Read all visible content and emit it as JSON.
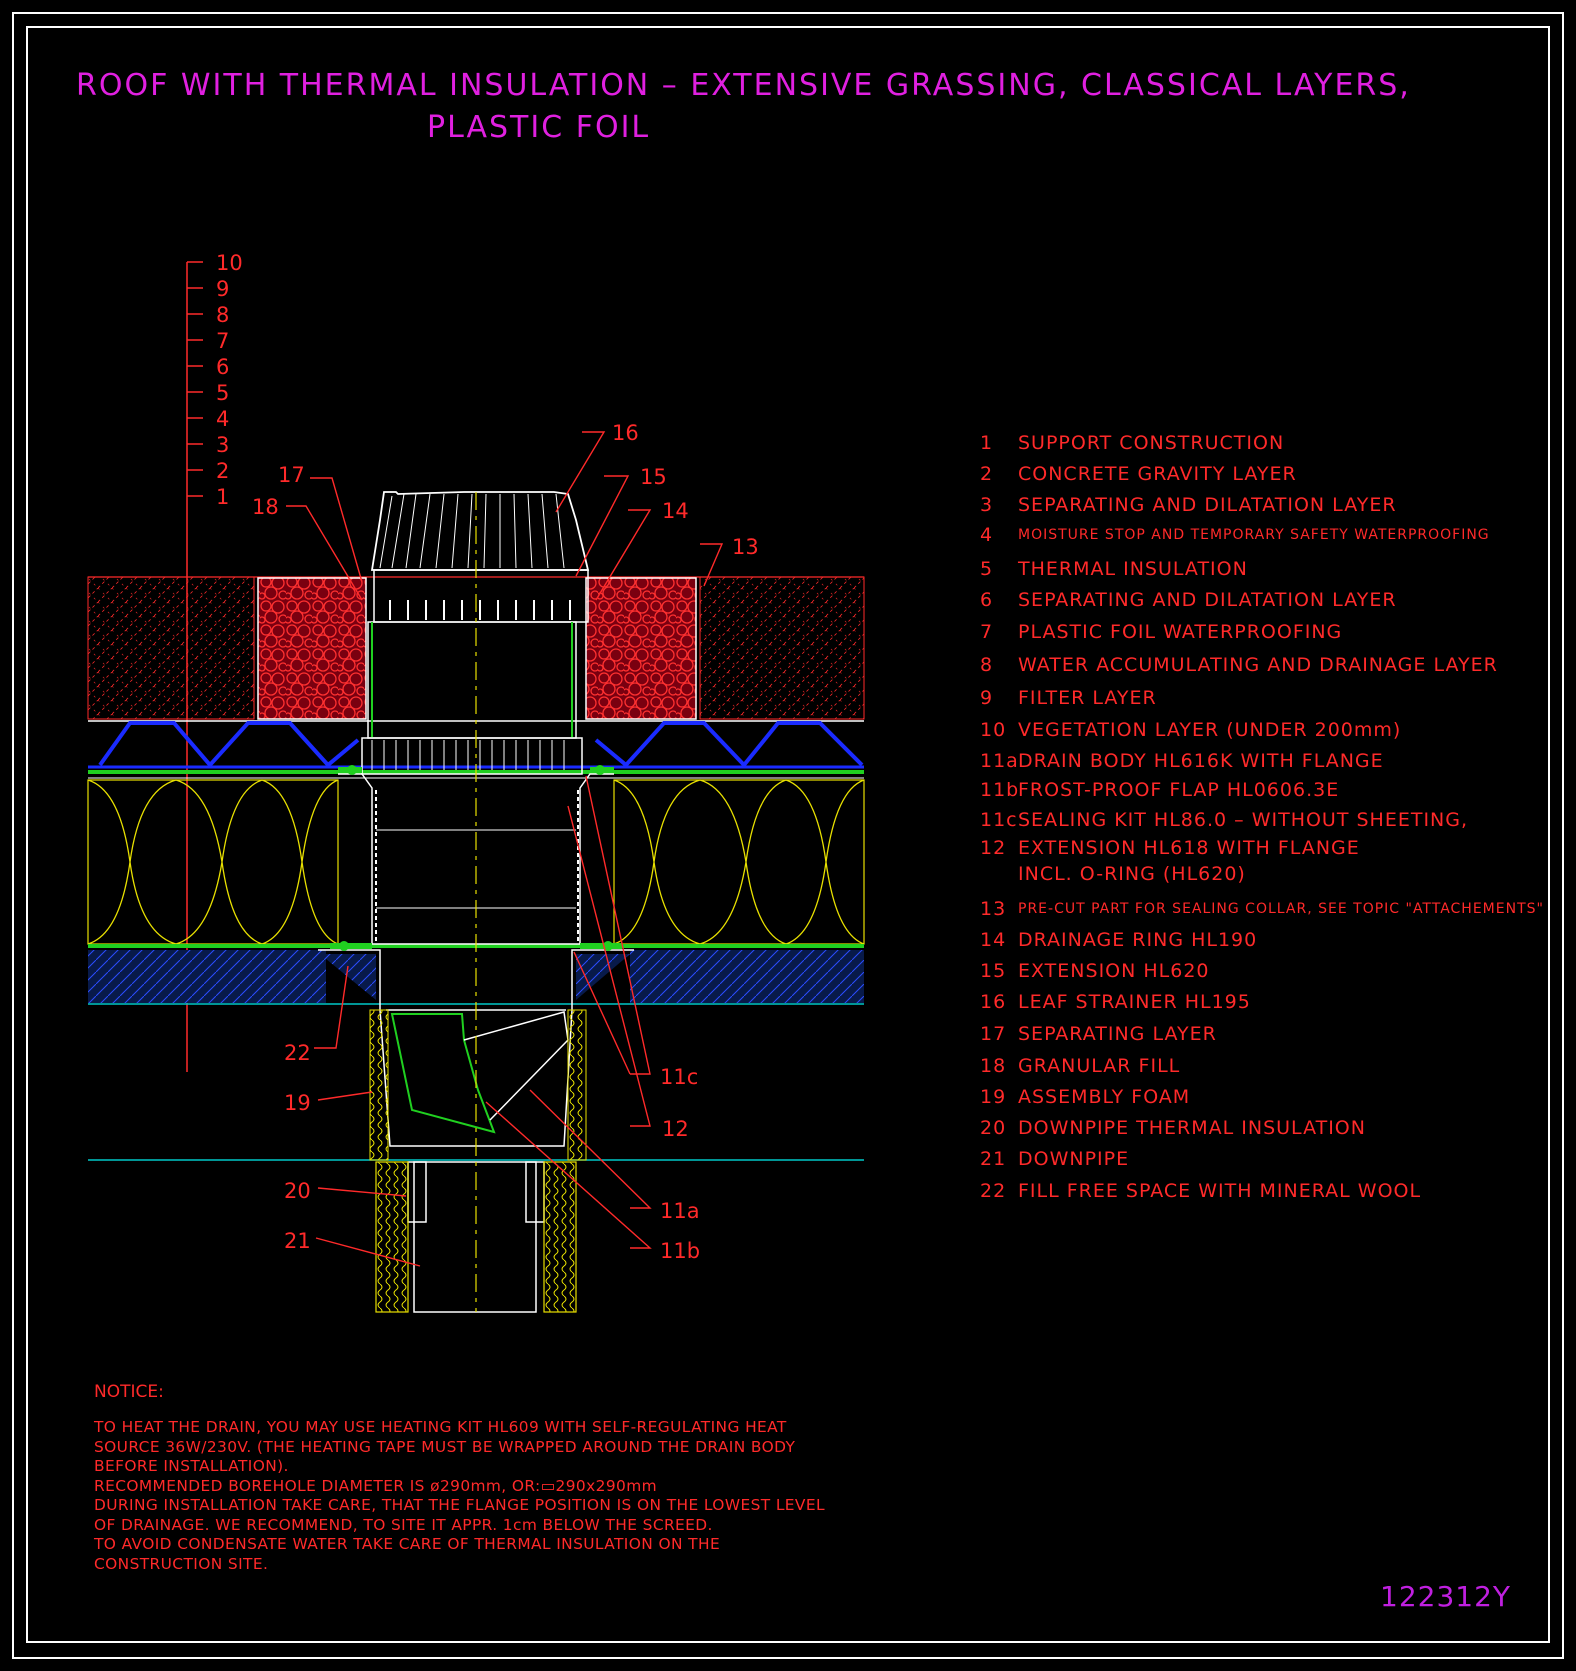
{
  "title": {
    "line1": "ROOF WITH THERMAL INSULATION – EXTENSIVE GRASSING, CLASSICAL LAYERS,",
    "line2": "PLASTIC FOIL"
  },
  "scale_labels": [
    "10",
    "9",
    "8",
    "7",
    "6",
    "5",
    "4",
    "3",
    "2",
    "1"
  ],
  "callouts": {
    "c16": "16",
    "c15": "15",
    "c14": "14",
    "c13": "13",
    "c17": "17",
    "c18": "18",
    "c22": "22",
    "c19": "19",
    "c20": "20",
    "c21": "21",
    "c11c": "11c",
    "c12": "12",
    "c11a": "11a",
    "c11b": "11b"
  },
  "legend": [
    {
      "num": "1",
      "text": "SUPPORT CONSTRUCTION"
    },
    {
      "num": "2",
      "text": "CONCRETE GRAVITY LAYER"
    },
    {
      "num": "3",
      "text": "SEPARATING AND DILATATION LAYER"
    },
    {
      "num": "4",
      "text": "MOISTURE STOP AND TEMPORARY SAFETY WATERPROOFING"
    },
    {
      "num": "5",
      "text": "THERMAL INSULATION"
    },
    {
      "num": "6",
      "text": "SEPARATING AND DILATATION LAYER"
    },
    {
      "num": "7",
      "text": "PLASTIC FOIL WATERPROOFING"
    },
    {
      "num": "8",
      "text": "WATER ACCUMULATING AND DRAINAGE LAYER"
    },
    {
      "num": "9",
      "text": "FILTER LAYER"
    },
    {
      "num": "10",
      "text": "VEGETATION LAYER (UNDER 200mm)"
    },
    {
      "num": "11a",
      "text": "DRAIN BODY HL616K WITH FLANGE"
    },
    {
      "num": "11b",
      "text": "FROST-PROOF FLAP HL0606.3E"
    },
    {
      "num": "11c",
      "text": "SEALING KIT HL86.0 – WITHOUT SHEETING,"
    },
    {
      "num": "12",
      "text": "EXTENSION HL618 WITH FLANGE"
    },
    {
      "num": "",
      "text": "INCL. O-RING (HL620)"
    },
    {
      "num": "13",
      "text": "PRE-CUT PART FOR SEALING COLLAR, SEE TOPIC \"ATTACHEMENTS\""
    },
    {
      "num": "14",
      "text": "DRAINAGE RING HL190"
    },
    {
      "num": "15",
      "text": "EXTENSION HL620"
    },
    {
      "num": "16",
      "text": "LEAF STRAINER HL195"
    },
    {
      "num": "17",
      "text": "SEPARATING LAYER"
    },
    {
      "num": "18",
      "text": "GRANULAR FILL"
    },
    {
      "num": "19",
      "text": "ASSEMBLY FOAM"
    },
    {
      "num": "20",
      "text": "DOWNPIPE THERMAL INSULATION"
    },
    {
      "num": "21",
      "text": "DOWNPIPE"
    },
    {
      "num": "22",
      "text": "FILL FREE SPACE WITH MINERAL WOOL"
    }
  ],
  "notice": {
    "title": "NOTICE:",
    "lines": [
      "TO HEAT THE DRAIN, YOU MAY USE HEATING KIT HL609 WITH SELF-REGULATING HEAT",
      "SOURCE 36W/230V. (THE HEATING TAPE MUST BE WRAPPED AROUND THE DRAIN BODY",
      "BEFORE INSTALLATION).",
      "RECOMMENDED BOREHOLE DIAMETER IS ø290mm, OR:▭290x290mm",
      "DURING INSTALLATION TAKE CARE, THAT THE FLANGE POSITION IS ON THE LOWEST LEVEL",
      "OF DRAINAGE. WE RECOMMEND, TO SITE IT APPR. 1cm BELOW THE SCREED.",
      "TO AVOID CONDENSATE WATER TAKE CARE OF THERMAL INSULATION ON THE",
      "CONSTRUCTION SITE."
    ]
  },
  "drawing_code": "122312Y",
  "colors": {
    "title": "#e020e0",
    "text": "#ff2a2a",
    "insulation": "#e8e000",
    "drainage": "#1a2bff",
    "green": "#20d020",
    "cyan": "#00c8c8",
    "structure": "#ffffff"
  }
}
